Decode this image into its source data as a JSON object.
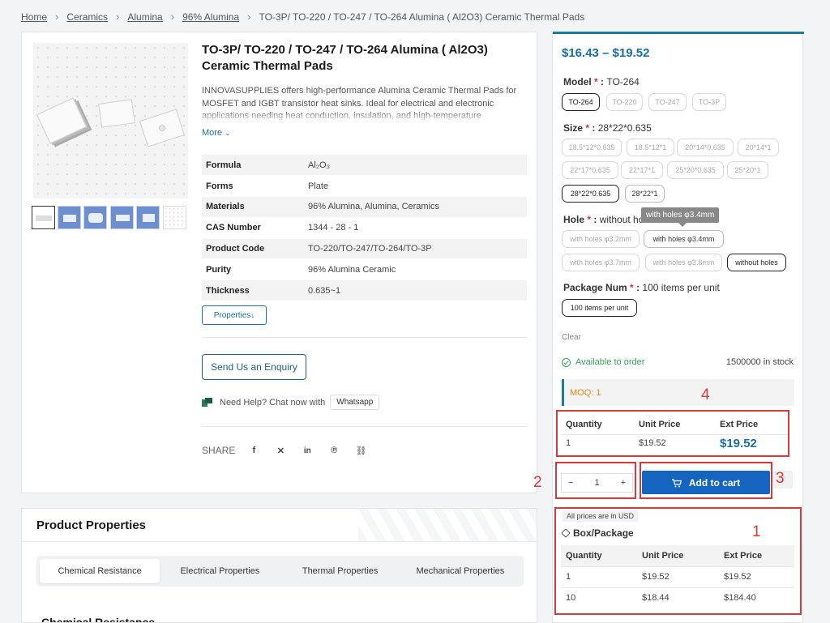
{
  "breadcrumb": {
    "items": [
      "Home",
      "Ceramics",
      "Alumina",
      "96% Alumina"
    ],
    "current": "TO-3P/ TO-220 / TO-247 / TO-264 Alumina ( Al2O3)  Ceramic Thermal Pads"
  },
  "product": {
    "title": "TO-3P/ TO-220 / TO-247 / TO-264 Alumina ( Al2O3) Ceramic Thermal Pads",
    "description": "INNOVASUPPLIES offers high-performance Alumina Ceramic Thermal Pads for MOSFET and IGBT transistor heat sinks. Ideal for electrical and electronic applications needing heat conduction, insulation, and high-temperature resistance, with excellent thermal conductivity and mechanical strength.",
    "more_label": "More",
    "specs": [
      {
        "key": "Formula",
        "value": "Al₂O₃",
        "link": true
      },
      {
        "key": "Forms",
        "value": "Plate",
        "link": true
      },
      {
        "key": "Materials",
        "value": "96% Alumina, Alumina, Ceramics",
        "link": true
      },
      {
        "key": "CAS Number",
        "value": "1344 - 28 - 1",
        "link": false
      },
      {
        "key": "Product Code",
        "value": "TO-220/TO-247/TO-264/TO-3P",
        "link": false
      },
      {
        "key": "Purity",
        "value": "96% Alumina Ceramic",
        "link": false
      },
      {
        "key": "Thickness",
        "value": "0.635~1",
        "link": false
      }
    ],
    "properties_button": "Properties↓",
    "enquiry_button": "Send Us an Enquiry",
    "help_text": "Need Help? Chat now with",
    "whatsapp_label": "Whatsapp",
    "share_label": "SHARE",
    "share_icons": [
      "facebook-icon",
      "x-icon",
      "linkedin-icon",
      "pinterest-icon",
      "link-icon"
    ]
  },
  "properties_section": {
    "title": "Product Properties",
    "tabs": [
      "Chemical Resistance",
      "Electrical Properties",
      "Thermal Properties",
      "Mechanical Properties"
    ],
    "active_tab": "Chemical Resistance",
    "section_heading": "Chemical Resistance"
  },
  "purchase": {
    "price_range": "$16.43 – $19.52",
    "model": {
      "label": "Model",
      "value": "TO-264",
      "options": [
        "TO-264",
        "TO-220",
        "TO-247",
        "TO-3P"
      ],
      "selected": "TO-264"
    },
    "size": {
      "label": "Size",
      "value": "28*22*0.635",
      "options": [
        "18.5*12*0.635",
        "18.5*12*1",
        "20*14*0.635",
        "20*14*1",
        "22*17*0.635",
        "22*17*1",
        "25*20*0.635",
        "25*20*1",
        "28*22*0.635",
        "28*22*1"
      ],
      "selected": "28*22*0.635"
    },
    "hole": {
      "label": "Hole",
      "value": "without holes",
      "options": [
        "with holes φ3.2mm",
        "with holes φ3.4mm",
        "with holes φ3.7mm",
        "with holes φ3.8mm",
        "without holes"
      ],
      "selected": "without holes",
      "tooltip": "with holes φ3.4mm"
    },
    "package": {
      "label": "Package Num",
      "value": "100 items per unit",
      "options": [
        "100 items per unit"
      ],
      "selected": "100 items per unit"
    },
    "clear_label": "Clear",
    "availability": "Available to order",
    "stock": "1500000 in stock",
    "moq": "MOQ: 1",
    "tier_summary": {
      "headers": [
        "Quantity",
        "Unit Price",
        "Ext Price"
      ],
      "row": [
        "1",
        "$19.52",
        "$19.52"
      ]
    },
    "quantity": {
      "minus": "−",
      "value": "1",
      "plus": "+"
    },
    "add_to_cart": "Add to cart",
    "usd_note": "All prices are in USD",
    "box_label": "Box/Package",
    "tier_table": {
      "headers": [
        "Quantity",
        "Unit Price",
        "Ext Price"
      ],
      "rows": [
        [
          "1",
          "$19.52",
          "$19.52"
        ],
        [
          "10",
          "$18.44",
          "$184.40"
        ]
      ]
    }
  },
  "annotations": [
    "1",
    "2",
    "3",
    "4"
  ],
  "colors": {
    "accent": "#1a6da0",
    "cart_button": "#1565c0",
    "annotation_red": "#d63b3b",
    "available_green": "#3aa05a",
    "moq_orange": "#e08a1e"
  }
}
